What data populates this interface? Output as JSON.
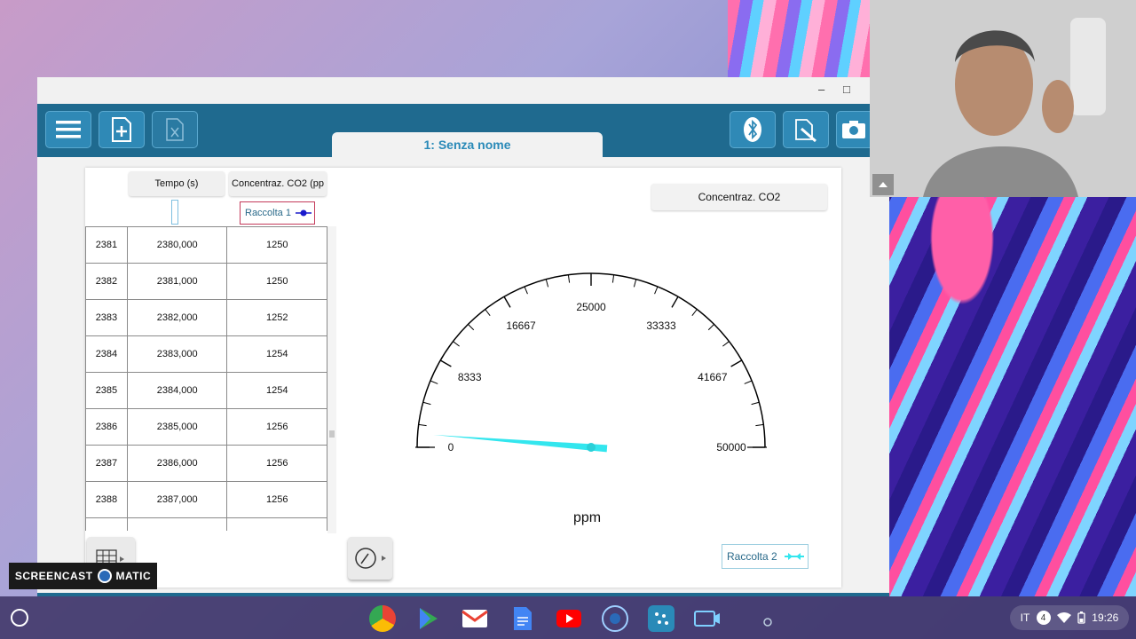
{
  "window": {
    "tab_title": "1: Senza nome",
    "minimize_glyph": "–",
    "maximize_glyph": "□"
  },
  "toolbar": {
    "icons": [
      "menu-icon",
      "new-file-icon",
      "excel-icon",
      "bluetooth-icon",
      "sensor-icon",
      "camera-icon"
    ]
  },
  "table": {
    "headers": {
      "time": "Tempo (s)",
      "co2": "Concentraz. CO2 (pp"
    },
    "series_label": "Raccolta 1",
    "rows": [
      [
        "2381",
        "2380,000",
        "1250"
      ],
      [
        "2382",
        "2381,000",
        "1250"
      ],
      [
        "2383",
        "2382,000",
        "1252"
      ],
      [
        "2384",
        "2383,000",
        "1254"
      ],
      [
        "2385",
        "2384,000",
        "1254"
      ],
      [
        "2386",
        "2385,000",
        "1256"
      ],
      [
        "2387",
        "2386,000",
        "1256"
      ],
      [
        "2388",
        "2387,000",
        "1256"
      ]
    ]
  },
  "gauge": {
    "title": "Concentraz. CO2",
    "min": 0,
    "max": 50000,
    "value": 1256,
    "tick_labels": [
      "0",
      "8333",
      "16667",
      "25000",
      "33333",
      "41667",
      "50000"
    ],
    "unit": "ppm",
    "needle_color": "#33e6ee",
    "legend_label": "Raccolta 2"
  },
  "watermark": {
    "left": "SCREENCAST",
    "right": "MATIC"
  },
  "shelf": {
    "lang": "IT",
    "badge": "4",
    "time": "19:26"
  },
  "colors": {
    "toolbar": "#1f6a8f",
    "button": "#2f89b6",
    "accent_text": "#2a8ab8"
  }
}
